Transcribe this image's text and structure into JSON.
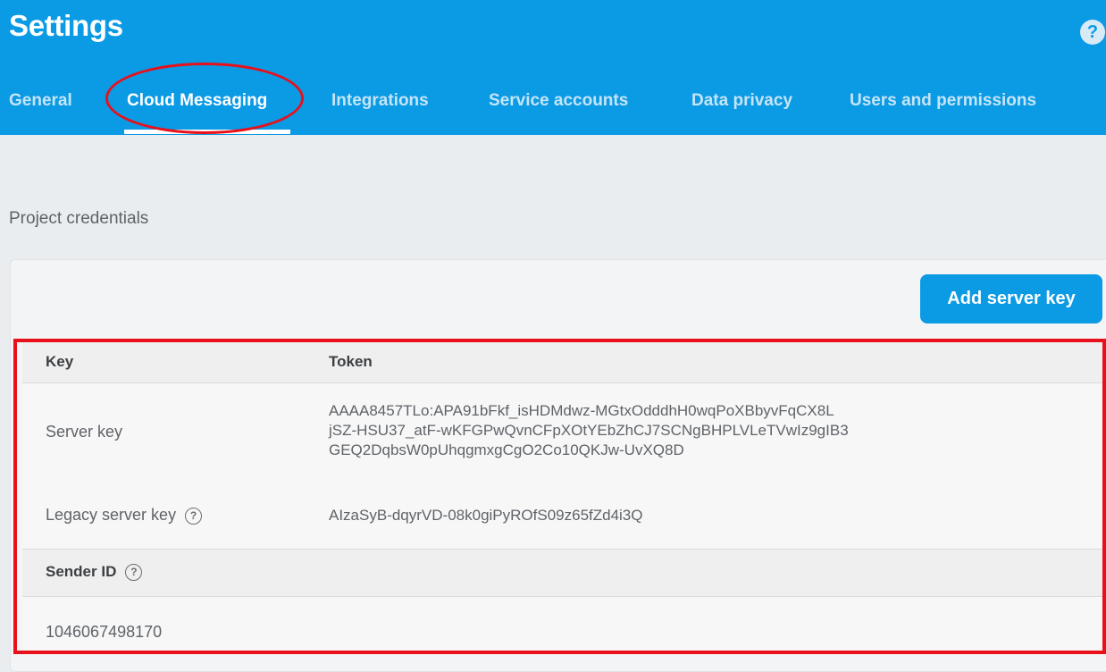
{
  "header": {
    "title": "Settings",
    "help_glyph": "?",
    "tabs": [
      {
        "label": "General",
        "active": false
      },
      {
        "label": "Cloud Messaging",
        "active": true
      },
      {
        "label": "Integrations",
        "active": false
      },
      {
        "label": "Service accounts",
        "active": false
      },
      {
        "label": "Data privacy",
        "active": false
      },
      {
        "label": "Users and permissions",
        "active": false
      }
    ]
  },
  "credentials": {
    "section_label": "Project credentials",
    "add_button": "Add server key",
    "table": {
      "col_key": "Key",
      "col_token": "Token",
      "rows": [
        {
          "key": "Server key",
          "token_lines": [
            "AAAA8457TLo:APA91bFkf_isHDMdwz-MGtxOdddhH0wqPoXBbyvFqCX8L",
            "jSZ-HSU37_atF-wKFGPwQvnCFpXOtYEbZhCJ7SCNgBHPLVLeTVwIz9gIB3",
            "GEQ2DqbsW0pUhqgmxgCgO2Co10QKJw-UvXQ8D"
          ]
        },
        {
          "key": "Legacy server key",
          "help": "?",
          "token": "AIzaSyB-dqyrVD-08k0giPyROfS09z65fZd4i3Q"
        }
      ]
    },
    "sender": {
      "label": "Sender ID",
      "help": "?",
      "value": "1046067498170"
    }
  },
  "colors": {
    "header_bg": "#0b9ae4",
    "highlight": "#e8101a",
    "page_bg": "#eaedf0"
  }
}
